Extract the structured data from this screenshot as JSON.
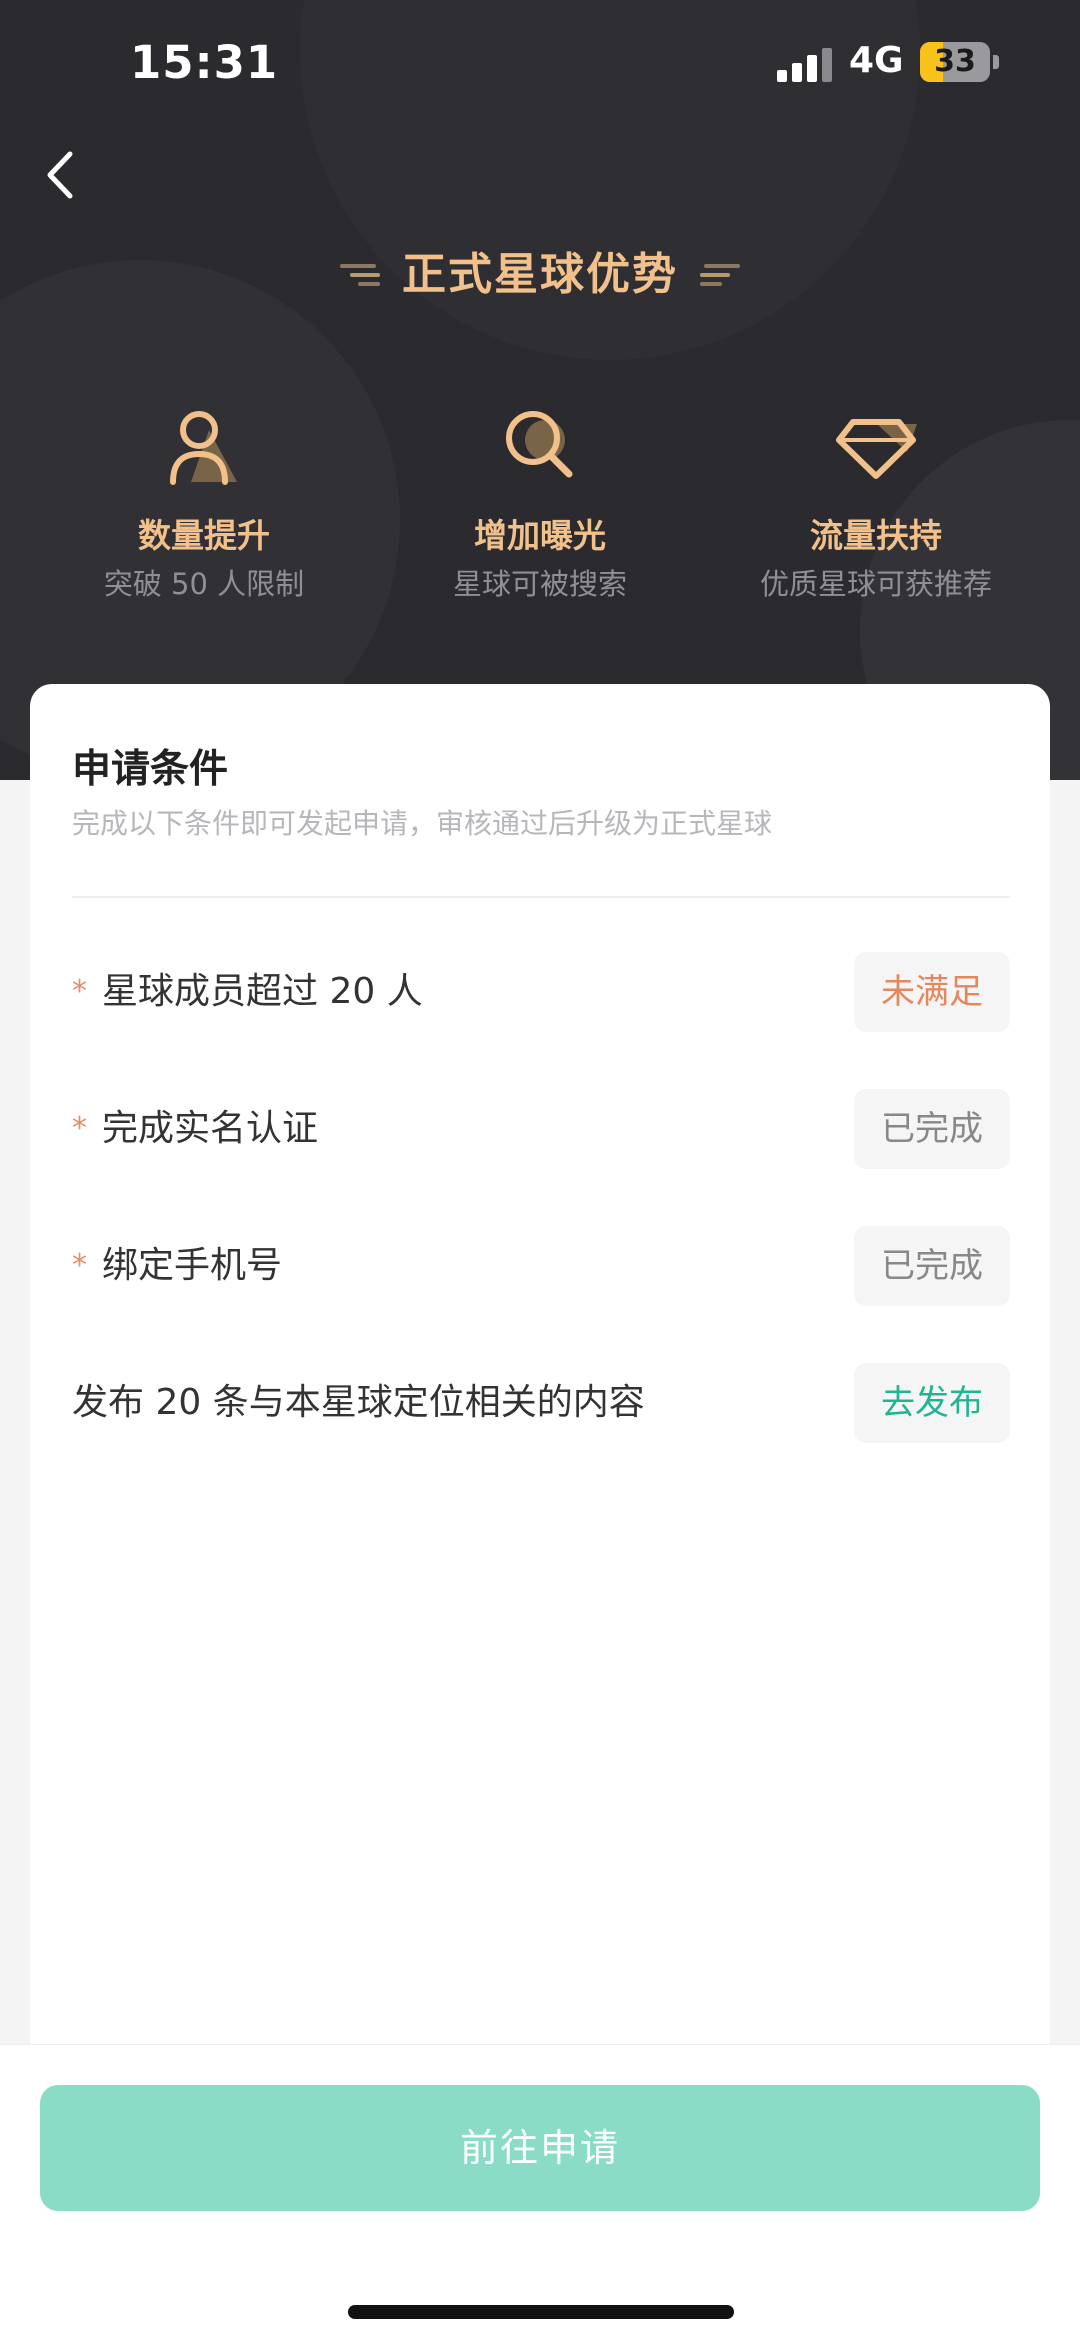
{
  "status_bar": {
    "time": "15:31",
    "network": "4G",
    "battery": "33",
    "battery_level": 0.33,
    "battery_color": "#f7c31a"
  },
  "header": {
    "title": "正式星球优势",
    "back_icon": "chevron-left-icon",
    "accent_color": "#f2c08a"
  },
  "benefits": [
    {
      "icon": "user-icon",
      "title": "数量提升",
      "desc": "突破 50 人限制"
    },
    {
      "icon": "search-icon",
      "title": "增加曝光",
      "desc": "星球可被搜索"
    },
    {
      "icon": "diamond-icon",
      "title": "流量扶持",
      "desc": "优质星球可获推荐"
    }
  ],
  "conditions_card": {
    "title": "申请条件",
    "subtitle": "完成以下条件即可发起申请，审核通过后升级为正式星球",
    "items": [
      {
        "required": true,
        "star": "*",
        "label": "星球成员超过 20 人",
        "status": "未满足",
        "status_color": "#e5875d"
      },
      {
        "required": true,
        "star": "*",
        "label": "完成实名认证",
        "status": "已完成",
        "status_color": "#888888"
      },
      {
        "required": true,
        "star": "*",
        "label": "绑定手机号",
        "status": "已完成",
        "status_color": "#888888"
      },
      {
        "required": false,
        "star": "",
        "label": "发布 20 条与本星球定位相关的内容",
        "status": "去发布",
        "status_color": "#1fb592"
      }
    ]
  },
  "footer": {
    "apply_button": "前往申请",
    "apply_button_color": "#8adcc7"
  }
}
